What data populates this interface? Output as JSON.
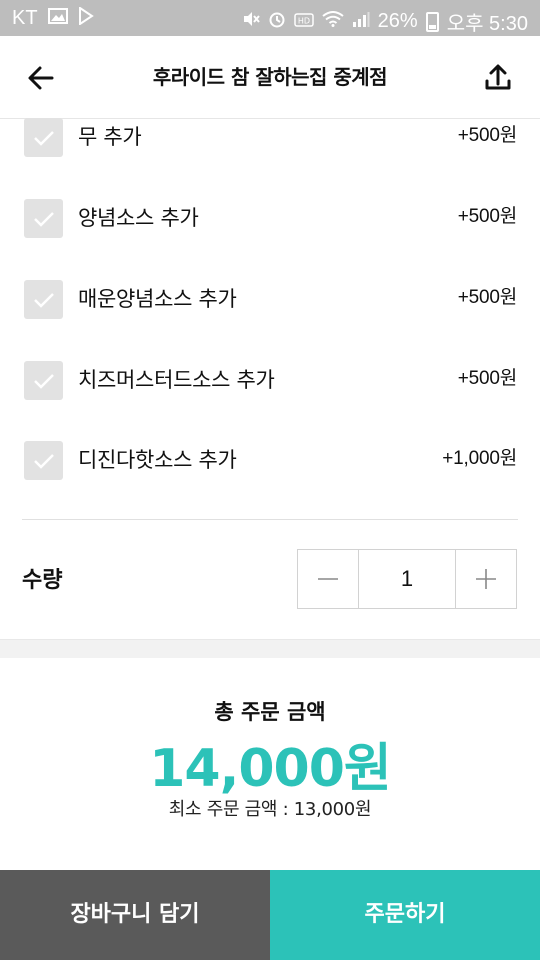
{
  "status_bar": {
    "carrier": "KT",
    "battery": "26%",
    "time": "오후 5:30"
  },
  "header": {
    "title": "후라이드 참 잘하는집 중계점",
    "back_icon": "arrow-left-icon",
    "share_icon": "share-upload-icon"
  },
  "options": [
    {
      "label": "무 추가",
      "price": "+500원",
      "checked": true
    },
    {
      "label": "양념소스 추가",
      "price": "+500원",
      "checked": true
    },
    {
      "label": "매운양념소스 추가",
      "price": "+500원",
      "checked": true
    },
    {
      "label": "치즈머스터드소스 추가",
      "price": "+500원",
      "checked": true
    },
    {
      "label": "디진다핫소스 추가",
      "price": "+1,000원",
      "checked": true
    }
  ],
  "quantity": {
    "label": "수량",
    "value": "1"
  },
  "total": {
    "label": "총 주문 금액",
    "amount": "14,000원",
    "min_order": "최소 주문 금액 : 13,000원"
  },
  "buttons": {
    "cart": "장바구니 담기",
    "order": "주문하기"
  },
  "colors": {
    "accent": "#2cc2b8",
    "cart_button": "#5a5a5a",
    "status_bar": "#bdbdbd"
  }
}
